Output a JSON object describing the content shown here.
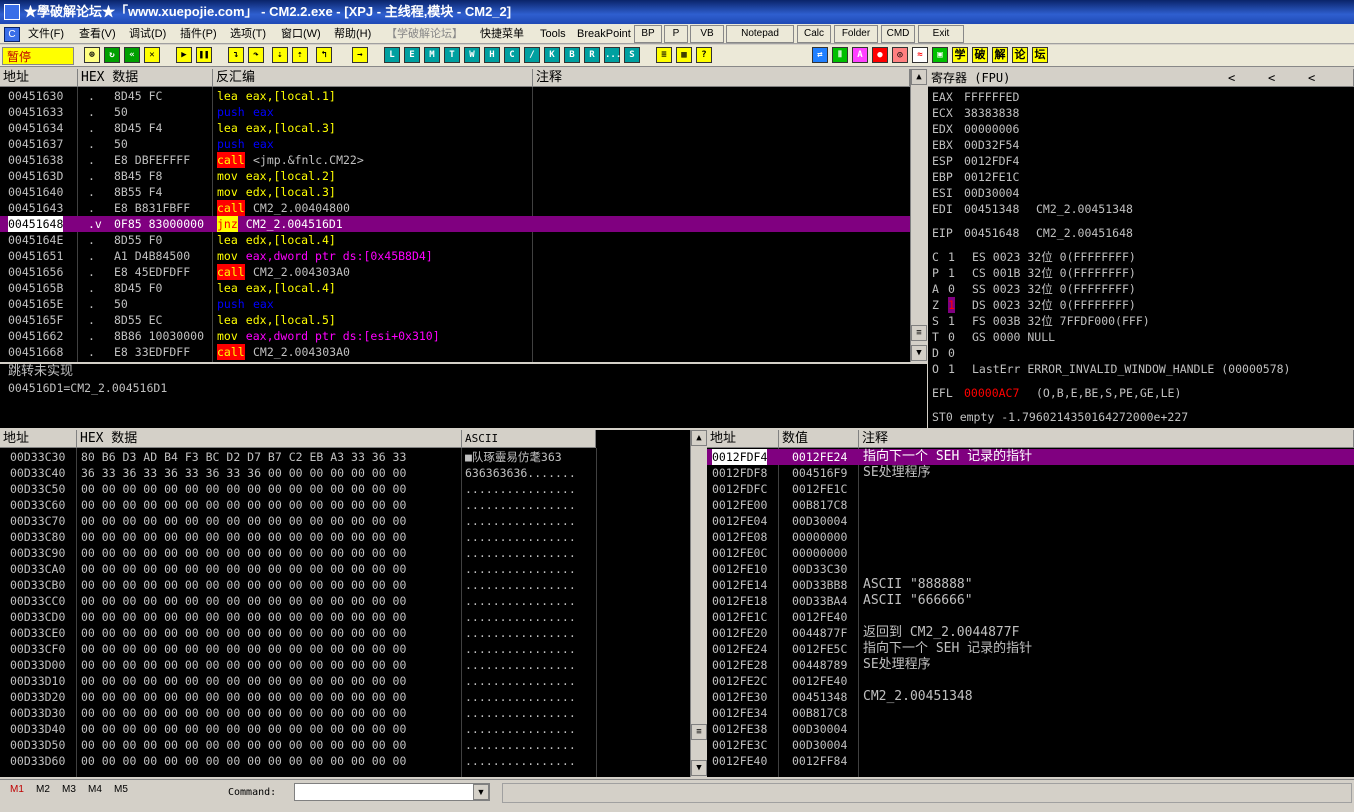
{
  "window": {
    "title": "★學破解论坛★「www.xuepojie.com」 - CM2.2.exe - [XPJ - 主线程,模块 - CM2_2]"
  },
  "menu": {
    "items": [
      "文件(F)",
      "查看(V)",
      "调试(D)",
      "插件(P)",
      "选项(T)",
      "窗口(W)",
      "帮助(H)",
      "【学破解论坛】",
      "快捷菜单",
      "Tools",
      "BreakPoint"
    ],
    "buttons": [
      "BP",
      "P",
      "VB",
      "Notepad",
      "Calc",
      "Folder",
      "CMD",
      "Exit"
    ]
  },
  "toolbar": {
    "status": "暂停",
    "letters": [
      "L",
      "E",
      "M",
      "T",
      "W",
      "H",
      "C",
      "/",
      "K",
      "B",
      "R",
      "...",
      "S"
    ],
    "chinese": [
      "学",
      "破",
      "解",
      "论",
      "坛"
    ]
  },
  "cpu": {
    "headers": {
      "addr": "地址",
      "hex": "HEX 数据",
      "disasm": "反汇编",
      "comment": "注释"
    },
    "rows": [
      {
        "addr": "00451630",
        "mark": ".",
        "hex": "8D45 FC",
        "op": "lea",
        "operand": "eax,[local.1]",
        "cls": "kw-lea",
        "sel": false
      },
      {
        "addr": "00451633",
        "mark": ".",
        "hex": "50",
        "op": "push",
        "operand": "eax",
        "cls": "kw-push",
        "sel": false
      },
      {
        "addr": "00451634",
        "mark": ".",
        "hex": "8D45 F4",
        "op": "lea",
        "operand": "eax,[local.3]",
        "cls": "kw-lea",
        "sel": false
      },
      {
        "addr": "00451637",
        "mark": ".",
        "hex": "50",
        "op": "push",
        "operand": "eax",
        "cls": "kw-push",
        "sel": false
      },
      {
        "addr": "00451638",
        "mark": ".",
        "hex": "E8 DBFEFFFF",
        "op": "call",
        "operand": "<jmp.&fnlc.CM22>",
        "cls": "kw-call",
        "sel": false
      },
      {
        "addr": "0045163D",
        "mark": ".",
        "hex": "8B45 F8",
        "op": "mov",
        "operand": "eax,[local.2]",
        "cls": "kw-mov",
        "sel": false
      },
      {
        "addr": "00451640",
        "mark": ".",
        "hex": "8B55 F4",
        "op": "mov",
        "operand": "edx,[local.3]",
        "cls": "kw-mov",
        "sel": false
      },
      {
        "addr": "00451643",
        "mark": ".",
        "hex": "E8 B831FBFF",
        "op": "call",
        "operand": "CM2_2.00404800",
        "cls": "kw-call",
        "sel": false
      },
      {
        "addr": "00451648",
        "mark": ".v",
        "hex": "0F85 83000000",
        "op": "jnz",
        "operand": "CM2_2.004516D1",
        "cls": "kw-jnz",
        "sel": true
      },
      {
        "addr": "0045164E",
        "mark": ".",
        "hex": "8D55 F0",
        "op": "lea",
        "operand": "edx,[local.4]",
        "cls": "kw-lea",
        "sel": false
      },
      {
        "addr": "00451651",
        "mark": ".",
        "hex": "A1 D4B84500",
        "op": "mov",
        "operand": "eax,dword ptr ds:[0x45B8D4]",
        "cls": "kw-mov",
        "sel": false
      },
      {
        "addr": "00451656",
        "mark": ".",
        "hex": "E8 45EDFDFF",
        "op": "call",
        "operand": "CM2_2.004303A0",
        "cls": "kw-call",
        "sel": false
      },
      {
        "addr": "0045165B",
        "mark": ".",
        "hex": "8D45 F0",
        "op": "lea",
        "operand": "eax,[local.4]",
        "cls": "kw-lea",
        "sel": false
      },
      {
        "addr": "0045165E",
        "mark": ".",
        "hex": "50",
        "op": "push",
        "operand": "eax",
        "cls": "kw-push",
        "sel": false
      },
      {
        "addr": "0045165F",
        "mark": ".",
        "hex": "8D55 EC",
        "op": "lea",
        "operand": "edx,[local.5]",
        "cls": "kw-lea",
        "sel": false
      },
      {
        "addr": "00451662",
        "mark": ".",
        "hex": "8B86 10030000",
        "op": "mov",
        "operand": "eax,dword ptr ds:[esi+0x310]",
        "cls": "kw-mov",
        "sel": false
      },
      {
        "addr": "00451668",
        "mark": ".",
        "hex": "E8 33EDFDFF",
        "op": "call",
        "operand": "CM2_2.004303A0",
        "cls": "kw-call",
        "sel": false
      }
    ]
  },
  "info": {
    "line1": "跳转未实现",
    "line2": "004516D1=CM2_2.004516D1"
  },
  "registers": {
    "header": "寄存器 (FPU)",
    "gp": [
      [
        "EAX",
        "FFFFFFED",
        ""
      ],
      [
        "ECX",
        "38383838",
        ""
      ],
      [
        "EDX",
        "00000006",
        ""
      ],
      [
        "EBX",
        "00D32F54",
        ""
      ],
      [
        "ESP",
        "0012FDF4",
        ""
      ],
      [
        "EBP",
        "0012FE1C",
        ""
      ],
      [
        "ESI",
        "00D30004",
        ""
      ],
      [
        "EDI",
        "00451348",
        "CM2_2.00451348"
      ]
    ],
    "eip": [
      "EIP",
      "00451648",
      "CM2_2.00451648"
    ],
    "flags": [
      [
        "C",
        "1",
        "ES 0023 32位 0(FFFFFFFF)"
      ],
      [
        "P",
        "1",
        "CS 001B 32位 0(FFFFFFFF)"
      ],
      [
        "A",
        "0",
        "SS 0023 32位 0(FFFFFFFF)"
      ],
      [
        "Z",
        "1",
        "DS 0023 32位 0(FFFFFFFF)"
      ],
      [
        "S",
        "1",
        "FS 003B 32位 7FFDF000(FFF)"
      ],
      [
        "T",
        "0",
        "GS 0000 NULL"
      ],
      [
        "D",
        "0",
        ""
      ],
      [
        "O",
        "1",
        "LastErr ERROR_INVALID_WINDOW_HANDLE (00000578)"
      ]
    ],
    "efl_label": "EFL",
    "efl_value": "00000AC7",
    "efl_desc": "(O,B,E,BE,S,PE,GE,LE)",
    "st0": "ST0 empty -1.7960214350164272000e+227"
  },
  "dump": {
    "headers": {
      "addr": "地址",
      "hex": "HEX 数据",
      "ascii": "ASCII"
    },
    "rows": [
      [
        "00D33C30",
        "80 B6 D3 AD B4 F3 BC D2 D7 B7 C2 EB A3 33 36 33",
        "■队琢靈易仿耄363"
      ],
      [
        "00D33C40",
        "36 33 36 33 36 33 36 33 36 00 00 00 00 00 00 00",
        "636363636......."
      ],
      [
        "00D33C50",
        "00 00 00 00 00 00 00 00 00 00 00 00 00 00 00 00",
        "................"
      ],
      [
        "00D33C60",
        "00 00 00 00 00 00 00 00 00 00 00 00 00 00 00 00",
        "................"
      ],
      [
        "00D33C70",
        "00 00 00 00 00 00 00 00 00 00 00 00 00 00 00 00",
        "................"
      ],
      [
        "00D33C80",
        "00 00 00 00 00 00 00 00 00 00 00 00 00 00 00 00",
        "................"
      ],
      [
        "00D33C90",
        "00 00 00 00 00 00 00 00 00 00 00 00 00 00 00 00",
        "................"
      ],
      [
        "00D33CA0",
        "00 00 00 00 00 00 00 00 00 00 00 00 00 00 00 00",
        "................"
      ],
      [
        "00D33CB0",
        "00 00 00 00 00 00 00 00 00 00 00 00 00 00 00 00",
        "................"
      ],
      [
        "00D33CC0",
        "00 00 00 00 00 00 00 00 00 00 00 00 00 00 00 00",
        "................"
      ],
      [
        "00D33CD0",
        "00 00 00 00 00 00 00 00 00 00 00 00 00 00 00 00",
        "................"
      ],
      [
        "00D33CE0",
        "00 00 00 00 00 00 00 00 00 00 00 00 00 00 00 00",
        "................"
      ],
      [
        "00D33CF0",
        "00 00 00 00 00 00 00 00 00 00 00 00 00 00 00 00",
        "................"
      ],
      [
        "00D33D00",
        "00 00 00 00 00 00 00 00 00 00 00 00 00 00 00 00",
        "................"
      ],
      [
        "00D33D10",
        "00 00 00 00 00 00 00 00 00 00 00 00 00 00 00 00",
        "................"
      ],
      [
        "00D33D20",
        "00 00 00 00 00 00 00 00 00 00 00 00 00 00 00 00",
        "................"
      ],
      [
        "00D33D30",
        "00 00 00 00 00 00 00 00 00 00 00 00 00 00 00 00",
        "................"
      ],
      [
        "00D33D40",
        "00 00 00 00 00 00 00 00 00 00 00 00 00 00 00 00",
        "................"
      ],
      [
        "00D33D50",
        "00 00 00 00 00 00 00 00 00 00 00 00 00 00 00 00",
        "................"
      ],
      [
        "00D33D60",
        "00 00 00 00 00 00 00 00 00 00 00 00 00 00 00 00",
        "................"
      ]
    ]
  },
  "stack": {
    "headers": {
      "addr": "地址",
      "value": "数值",
      "comment": "注释"
    },
    "rows": [
      [
        "0012FDF4",
        "0012FE24",
        "指向下一个 SEH 记录的指针",
        true
      ],
      [
        "0012FDF8",
        "004516F9",
        "SE处理程序",
        false
      ],
      [
        "0012FDFC",
        "0012FE1C",
        "",
        false
      ],
      [
        "0012FE00",
        "00B817C8",
        "",
        false
      ],
      [
        "0012FE04",
        "00D30004",
        "",
        false
      ],
      [
        "0012FE08",
        "00000000",
        "",
        false
      ],
      [
        "0012FE0C",
        "00000000",
        "",
        false
      ],
      [
        "0012FE10",
        "00D33C30",
        "",
        false
      ],
      [
        "0012FE14",
        "00D33BB8",
        "ASCII \"888888\"",
        false
      ],
      [
        "0012FE18",
        "00D33BA4",
        "ASCII \"666666\"",
        false
      ],
      [
        "0012FE1C",
        "0012FE40",
        "",
        false
      ],
      [
        "0012FE20",
        "0044877F",
        "返回到 CM2_2.0044877F",
        false
      ],
      [
        "0012FE24",
        "0012FE5C",
        "指向下一个 SEH 记录的指针",
        false
      ],
      [
        "0012FE28",
        "00448789",
        "SE处理程序",
        false
      ],
      [
        "0012FE2C",
        "0012FE40",
        "",
        false
      ],
      [
        "0012FE30",
        "00451348",
        "CM2_2.00451348",
        false
      ],
      [
        "0012FE34",
        "00B817C8",
        "",
        false
      ],
      [
        "0012FE38",
        "00D30004",
        "",
        false
      ],
      [
        "0012FE3C",
        "00D30004",
        "",
        false
      ],
      [
        "0012FE40",
        "0012FF84",
        "",
        false
      ]
    ]
  },
  "statusbar": {
    "tabs": [
      "M1",
      "M2",
      "M3",
      "M4",
      "M5"
    ],
    "command_label": "Command:",
    "command_value": ""
  }
}
